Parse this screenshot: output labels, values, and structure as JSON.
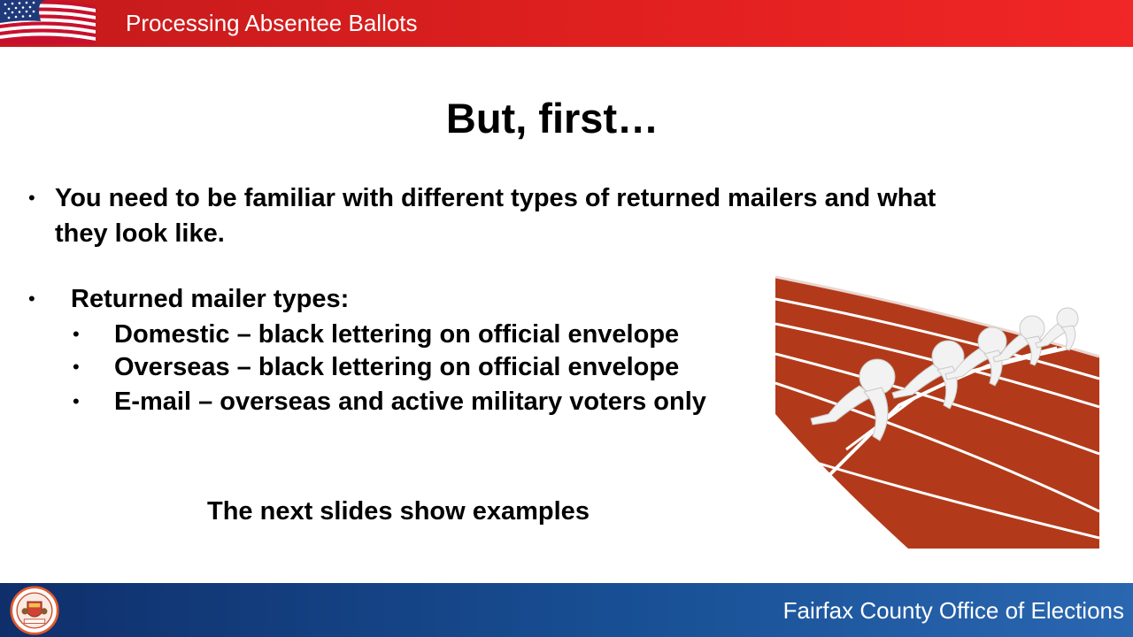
{
  "header": {
    "title": "Processing Absentee Ballots",
    "flag_icon": "us-flag-icon"
  },
  "slide": {
    "heading": "But, first…",
    "intro_bullet": {
      "line1": "You need to be familiar with different types of returned mailers and what",
      "line2": "they look like."
    },
    "types_bullet": "Returned mailer types:",
    "sub_bullets": [
      "Domestic – black lettering on official envelope",
      "Overseas – black lettering on official envelope",
      "E-mail – overseas and active military voters only"
    ],
    "closing": "The next slides show examples",
    "bullet_char": "•"
  },
  "footer": {
    "org": "Fairfax County Office of Elections",
    "seal_icon": "county-seal-icon"
  },
  "colors": {
    "top_bar": "#e0201f",
    "bottom_bar": "#184f94",
    "track": "#b23a1a"
  }
}
